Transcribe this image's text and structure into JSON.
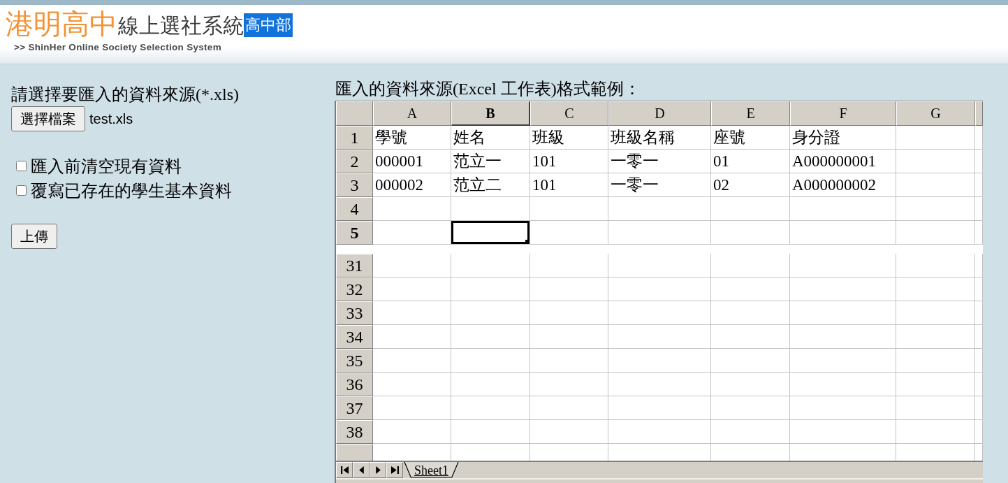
{
  "header": {
    "school": "港明高中",
    "system": "線上選社系統",
    "division": "高中部",
    "subtitle": "**>>** ShinHer Online Society Selection System"
  },
  "import_form": {
    "prompt": "請選擇要匯入的資料來源(*.xls)",
    "file_button": "選擇檔案",
    "file_name": "test.xls",
    "options": [
      {
        "label": "匯入前清空現有資料",
        "checked": false
      },
      {
        "label": "覆寫已存在的學生基本資料",
        "checked": false
      }
    ],
    "upload_button": "上傳"
  },
  "sample": {
    "caption": "匯入的資料來源(Excel 工作表)格式範例：",
    "sheet": {
      "columns": [
        {
          "label": "A",
          "selected": false
        },
        {
          "label": "B",
          "selected": true
        },
        {
          "label": "C",
          "selected": false
        },
        {
          "label": "D",
          "selected": false
        },
        {
          "label": "E",
          "selected": false
        },
        {
          "label": "F",
          "selected": false
        },
        {
          "label": "G",
          "selected": false
        }
      ],
      "panes": [
        {
          "rows": [
            {
              "label": "1",
              "selected": false,
              "cells": [
                "學號",
                "姓名",
                "班級",
                "班級名稱",
                "座號",
                "身分證"
              ]
            },
            {
              "label": "2",
              "selected": false,
              "cells": [
                "000001",
                "范立一",
                "101",
                "一零一",
                "01",
                "A000000001"
              ]
            },
            {
              "label": "3",
              "selected": false,
              "cells": [
                "000002",
                "范立二",
                "101",
                "一零一",
                "02",
                "A000000002"
              ]
            },
            {
              "label": "4",
              "selected": false
            },
            {
              "label": "5",
              "selected": true
            }
          ]
        },
        {
          "rows": [
            {
              "label": "31",
              "selected": false
            },
            {
              "label": "32",
              "selected": false
            },
            {
              "label": "33",
              "selected": false
            },
            {
              "label": "34",
              "selected": false
            },
            {
              "label": "35",
              "selected": false
            },
            {
              "label": "36",
              "selected": false
            },
            {
              "label": "37",
              "selected": false
            },
            {
              "label": "38",
              "selected": false
            }
          ]
        }
      ],
      "sheet_tabs": [
        {
          "label": "Sheet1",
          "selected": true
        }
      ]
    }
  }
}
